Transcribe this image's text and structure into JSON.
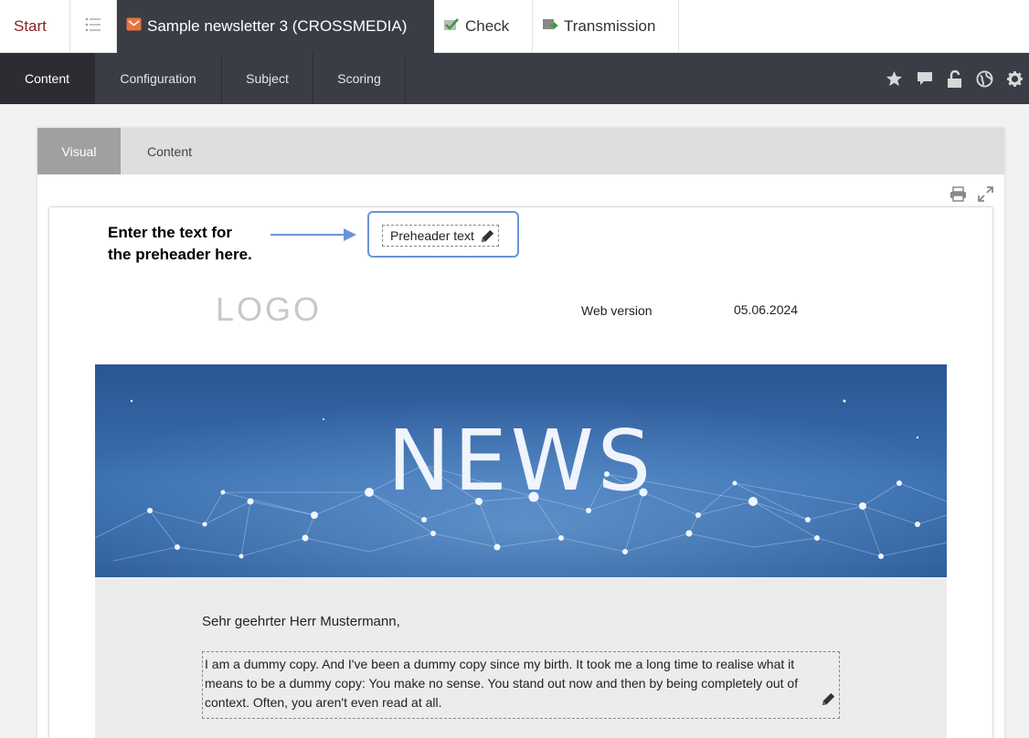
{
  "top_tabs": {
    "start": "Start",
    "newsletter": "Sample newsletter 3 (CROSSMEDIA)",
    "check": "Check",
    "transmission": "Transmission"
  },
  "nav_tabs": [
    "Content",
    "Configuration",
    "Subject",
    "Scoring"
  ],
  "sub_tabs": [
    "Visual",
    "Content"
  ],
  "annotation": {
    "line1": "Enter the text for",
    "line2": "the preheader here."
  },
  "newsletter": {
    "preheader": "Preheader text",
    "logo": "LOGO",
    "web_version": "Web version",
    "date": "05.06.2024",
    "banner_title": "NEWS",
    "greeting": "Sehr geehrter Herr Mustermann,",
    "body_line1": "I am a dummy copy. And I've been a dummy copy since my birth. It took me a long time to realise what it",
    "body_line2": "means to be a dummy copy: You make no sense. You stand out now and then by being completely out of",
    "body_line3": "context. Often, you aren't even read at all."
  },
  "colors": {
    "nav_bg": "#3a3d45",
    "start_text": "#8b1e1e",
    "annotation_border": "#6b94d6",
    "banner_bg": "#2f5d9a"
  },
  "icons": [
    "list-icon",
    "newsletter-icon",
    "check-icon",
    "transmission-icon",
    "star-icon",
    "comment-icon",
    "unlock-icon",
    "globe-icon",
    "gear-icon",
    "print-icon",
    "expand-icon",
    "pencil-icon"
  ]
}
